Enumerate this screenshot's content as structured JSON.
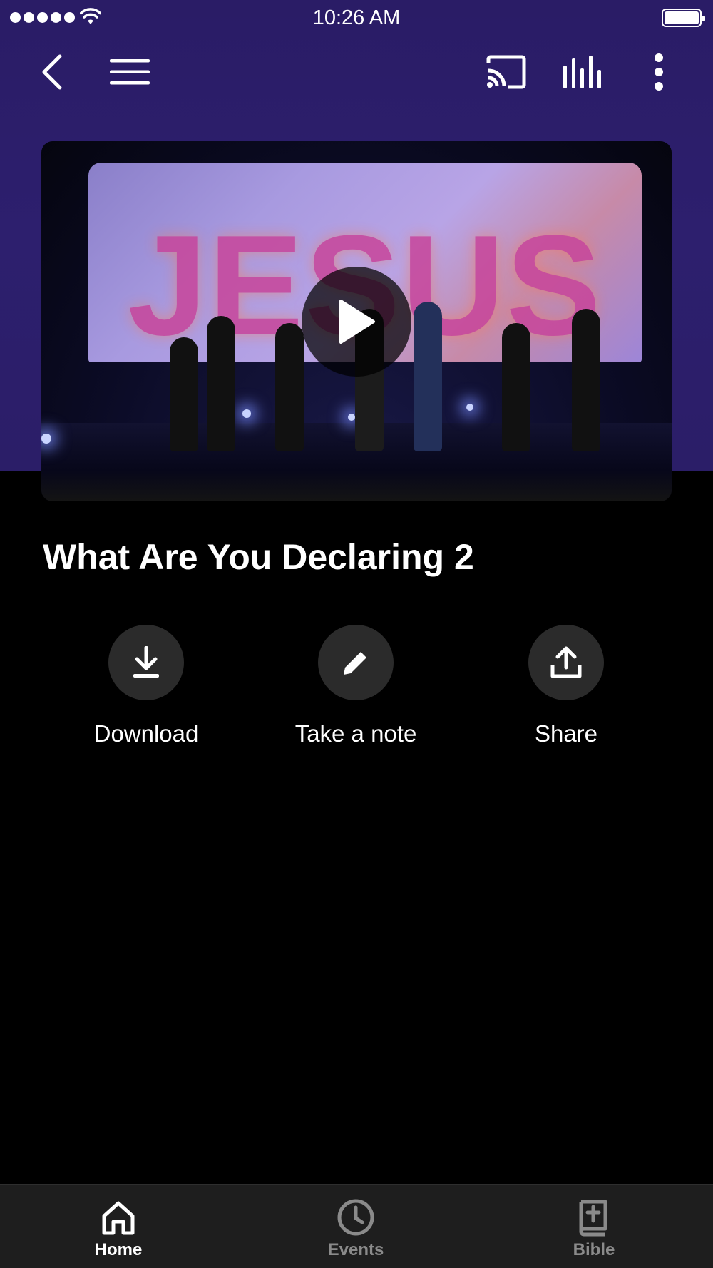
{
  "status_bar": {
    "time": "10:26 AM"
  },
  "toolbar": {
    "back_icon": "chevron-left-icon",
    "menu_icon": "hamburger-icon",
    "cast_icon": "cast-icon",
    "audio_icon": "audio-bars-icon",
    "more_icon": "more-vertical-icon"
  },
  "video": {
    "screen_text": "JESUS",
    "play_icon": "play-icon"
  },
  "title": "What Are You Declaring 2",
  "actions": [
    {
      "label": "Download",
      "icon": "download-icon"
    },
    {
      "label": "Take a note",
      "icon": "pencil-icon"
    },
    {
      "label": "Share",
      "icon": "share-icon"
    }
  ],
  "tabs": [
    {
      "label": "Home",
      "icon": "home-icon",
      "active": true
    },
    {
      "label": "Events",
      "icon": "clock-icon",
      "active": false
    },
    {
      "label": "Bible",
      "icon": "bible-icon",
      "active": false
    }
  ],
  "colors": {
    "header_bg": "#2d1f6e",
    "action_circle": "#2b2b2b",
    "tabbar_bg": "#1e1e1e",
    "inactive_tab": "#8a8a8a"
  }
}
